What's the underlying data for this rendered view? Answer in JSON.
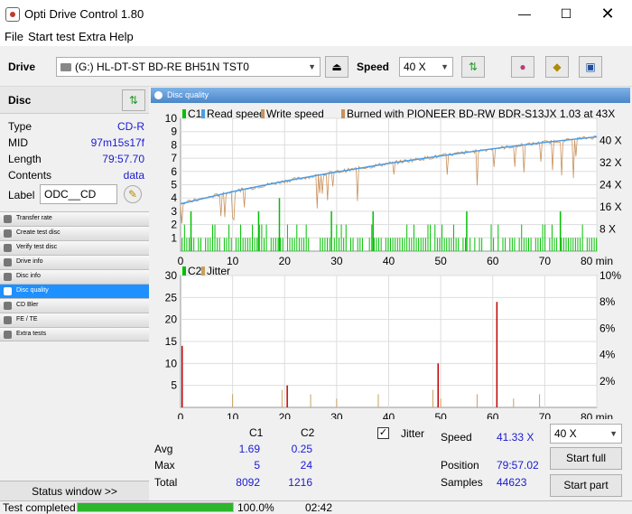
{
  "window": {
    "title": "Opti Drive Control 1.80"
  },
  "menu": [
    "File",
    "Start test",
    "Extra",
    "Help"
  ],
  "toolbar": {
    "drive_label": "Drive",
    "drive_value": "(G:)  HL-DT-ST BD-RE  BH51N TST0",
    "speed_label": "Speed",
    "speed_value": "40 X"
  },
  "disc": {
    "header": "Disc",
    "rows": [
      {
        "key": "Type",
        "value": "CD-R"
      },
      {
        "key": "MID",
        "value": "97m15s17f"
      },
      {
        "key": "Length",
        "value": "79:57.70"
      },
      {
        "key": "Contents",
        "value": "data"
      }
    ],
    "label_key": "Label",
    "label_value": "ODC__CD"
  },
  "nav": [
    "Transfer rate",
    "Create test disc",
    "Verify test disc",
    "Drive info",
    "Disc info",
    "Disc quality",
    "CD Bler",
    "FE / TE",
    "Extra tests"
  ],
  "nav_selected": 5,
  "status_window": "Status window >>",
  "status": {
    "text": "Test completed",
    "progress_percent": 100.0,
    "percent_label": "100.0%",
    "time": "02:42"
  },
  "panel_title": "Disc quality",
  "chart_data": [
    {
      "type": "line",
      "legend": [
        "C1",
        "Read speed",
        "Write speed",
        "Burned with PIONEER BD-RW  BDR-S13JX 1.03 at 43X"
      ],
      "colors": {
        "c1": "#00c000",
        "read": "#4a9ee8",
        "write": "#c8905a",
        "burn": "#c8905a"
      },
      "xlim": [
        0,
        80
      ],
      "ylim": [
        0,
        10
      ],
      "x_ticks": [
        "0",
        "10",
        "20",
        "30",
        "40",
        "50",
        "60",
        "70",
        "80 min"
      ],
      "y_ticks": [
        "1",
        "2",
        "3",
        "4",
        "5",
        "6",
        "7",
        "8",
        "9",
        "10"
      ],
      "y2_ticks": [
        "8 X",
        "16 X",
        "24 X",
        "32 X",
        "40 X"
      ],
      "read_speed_x": [
        0,
        10,
        20,
        30,
        40,
        50,
        60,
        70,
        80
      ],
      "read_speed_y2": [
        17.1,
        21.5,
        25.3,
        28.6,
        31.7,
        34.4,
        37.0,
        39.3,
        41.3
      ],
      "c1_peaks": [
        {
          "x": 2,
          "y": 3
        },
        {
          "x": 15,
          "y": 3
        },
        {
          "x": 19,
          "y": 4
        },
        {
          "x": 29,
          "y": 3
        },
        {
          "x": 37,
          "y": 3
        },
        {
          "x": 55,
          "y": 3
        },
        {
          "x": 73,
          "y": 3
        }
      ]
    },
    {
      "type": "bar",
      "legend": [
        "C2",
        "Jitter"
      ],
      "colors": {
        "c2": "#c00000",
        "jitter": "#c8a060"
      },
      "xlim": [
        0,
        80
      ],
      "ylim": [
        0,
        30
      ],
      "x_ticks": [
        "0",
        "10",
        "20",
        "30",
        "40",
        "50",
        "60",
        "70",
        "80 min"
      ],
      "y_ticks": [
        "5",
        "10",
        "15",
        "20",
        "25",
        "30"
      ],
      "y2_ticks": [
        "2%",
        "4%",
        "6%",
        "8%",
        "10%"
      ],
      "c2_bars": [
        {
          "x": 0.3,
          "y": 14
        },
        {
          "x": 20.5,
          "y": 5
        },
        {
          "x": 49.5,
          "y": 10
        },
        {
          "x": 60.8,
          "y": 24
        }
      ],
      "jitter_bars": [
        {
          "x": 10,
          "y": 3
        },
        {
          "x": 19.5,
          "y": 4
        },
        {
          "x": 25,
          "y": 3
        },
        {
          "x": 30,
          "y": 2
        },
        {
          "x": 38,
          "y": 3
        },
        {
          "x": 48.5,
          "y": 4
        },
        {
          "x": 50,
          "y": 2
        },
        {
          "x": 57,
          "y": 3
        },
        {
          "x": 64,
          "y": 2
        },
        {
          "x": 69,
          "y": 3
        }
      ]
    }
  ],
  "stats": {
    "col1": "C1",
    "col2": "C2",
    "rows": [
      {
        "label": "Avg",
        "c1": "1.69",
        "c2": "0.25"
      },
      {
        "label": "Max",
        "c1": "5",
        "c2": "24"
      },
      {
        "label": "Total",
        "c1": "8092",
        "c2": "1216"
      }
    ],
    "jitter_label": "Jitter",
    "jitter_checked": true,
    "speed_label": "Speed",
    "speed_value": "41.33 X",
    "position_label": "Position",
    "position_value": "79:57.02",
    "samples_label": "Samples",
    "samples_value": "44623",
    "speed_select": "40 X",
    "start_full": "Start full",
    "start_part": "Start part"
  }
}
